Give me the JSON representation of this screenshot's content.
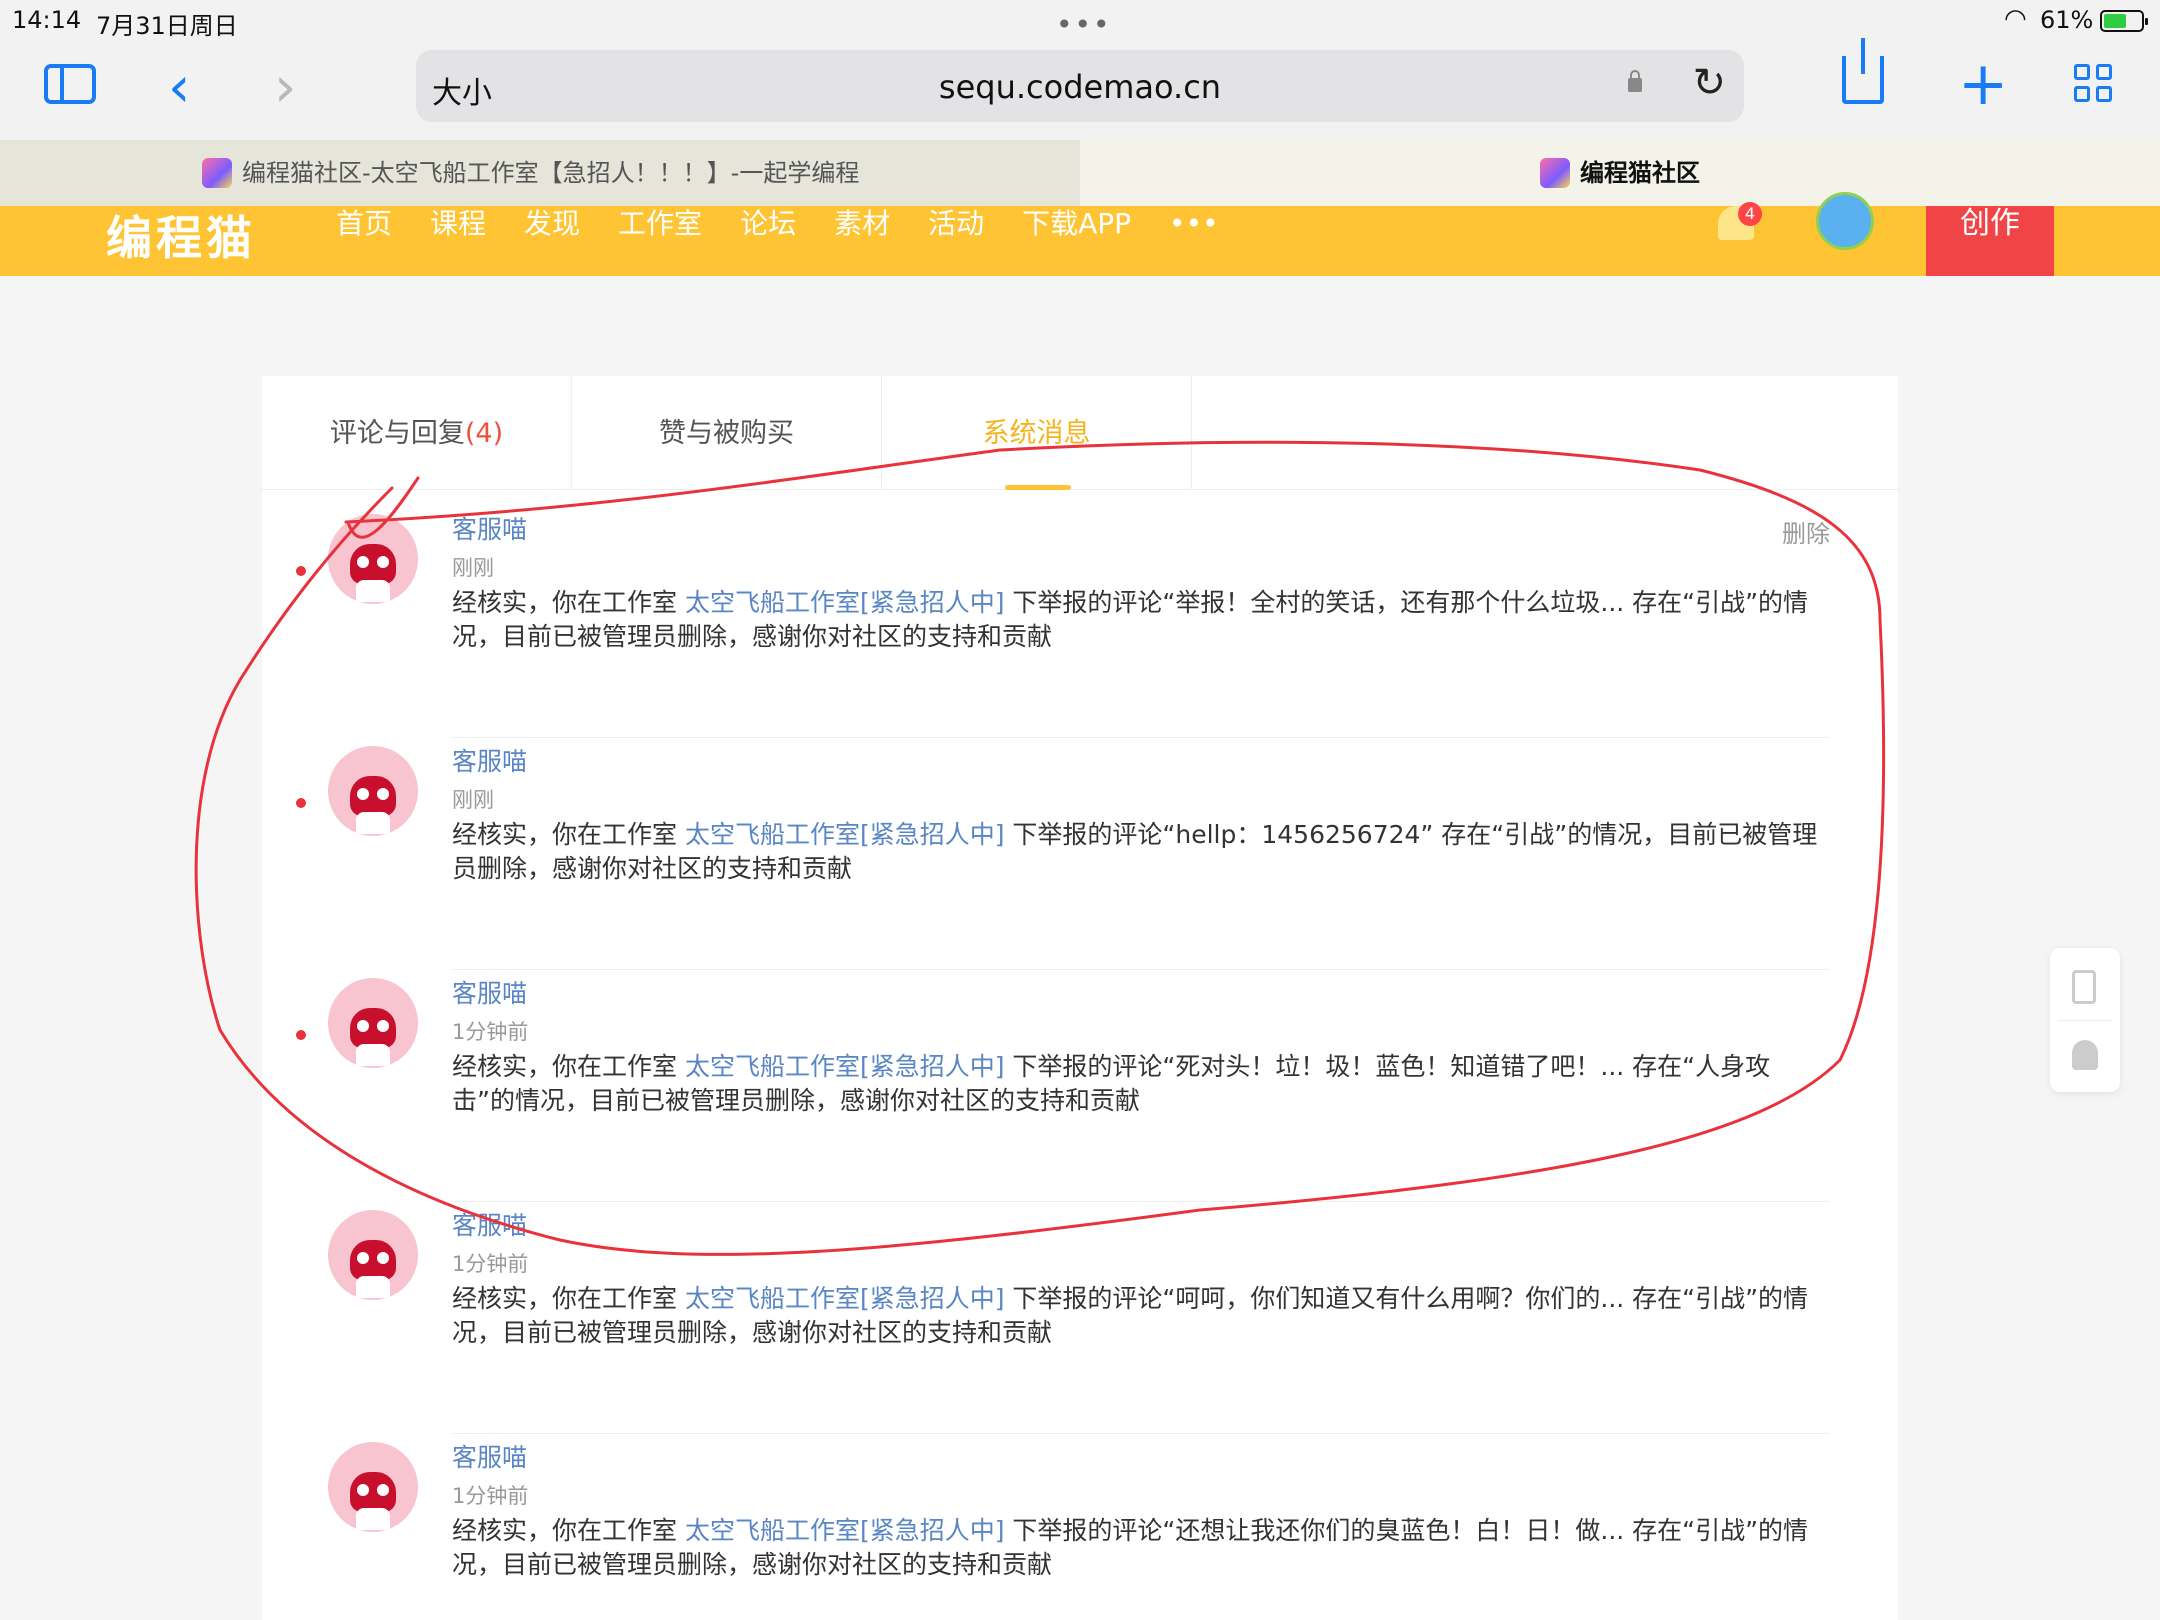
{
  "status_bar": {
    "time": "14:14",
    "date": "7月31日周日",
    "battery_percent_text": "61%",
    "battery_level": 0.61
  },
  "browser": {
    "text_size_label": "大小",
    "url": "sequ.codemao.cn",
    "tabs": [
      {
        "title": "编程猫社区-太空飞船工作室【急招人！！！】-一起学编程",
        "active": false
      },
      {
        "title": "编程猫社区",
        "active": true
      }
    ]
  },
  "site": {
    "logo": "编程猫",
    "nav": [
      "首页",
      "课程",
      "发现",
      "工作室",
      "论坛",
      "素材",
      "活动",
      "下载APP",
      "•••"
    ],
    "notification_count": "4",
    "create_label": "创作"
  },
  "message_tabs": [
    {
      "label": "评论与回复",
      "count": "(4)"
    },
    {
      "label": "赞与被购买",
      "count": ""
    },
    {
      "label": "系统消息",
      "count": ""
    }
  ],
  "messages": [
    {
      "sender": "客服喵",
      "time": "刚刚",
      "unread": true,
      "delete_label": "删除",
      "prefix": "经核实，你在工作室 ",
      "studio": "太空飞船工作室[紧急招人中]",
      "suffix": " 下举报的评论“举报！全村的笑话，还有那个什么垃圾... 存在“引战”的情况，目前已被管理员删除，感谢你对社区的支持和贡献"
    },
    {
      "sender": "客服喵",
      "time": "刚刚",
      "unread": true,
      "delete_label": "",
      "prefix": "经核实，你在工作室 ",
      "studio": "太空飞船工作室[紧急招人中]",
      "suffix": " 下举报的评论“hellp：1456256724” 存在“引战”的情况，目前已被管理员删除，感谢你对社区的支持和贡献"
    },
    {
      "sender": "客服喵",
      "time": "1分钟前",
      "unread": true,
      "delete_label": "",
      "prefix": "经核实，你在工作室 ",
      "studio": "太空飞船工作室[紧急招人中]",
      "suffix": " 下举报的评论“死对头！垃！圾！蓝色！知道错了吧！... 存在“人身攻击”的情况，目前已被管理员删除，感谢你对社区的支持和贡献"
    },
    {
      "sender": "客服喵",
      "time": "1分钟前",
      "unread": false,
      "delete_label": "",
      "prefix": "经核实，你在工作室 ",
      "studio": "太空飞船工作室[紧急招人中]",
      "suffix": " 下举报的评论“呵呵，你们知道又有什么用啊？你们的... 存在“引战”的情况，目前已被管理员删除，感谢你对社区的支持和贡献"
    },
    {
      "sender": "客服喵",
      "time": "1分钟前",
      "unread": false,
      "delete_label": "",
      "prefix": "经核实，你在工作室 ",
      "studio": "太空飞船工作室[紧急招人中]",
      "suffix": " 下举报的评论“还想让我还你们的臭蓝色！白！日！做... 存在“引战”的情况，目前已被管理员删除，感谢你对社区的支持和贡献"
    }
  ],
  "colors": {
    "header": "#fec433",
    "create_button": "#f04447",
    "link": "#5a86c4",
    "annotation": "#e8323c"
  }
}
